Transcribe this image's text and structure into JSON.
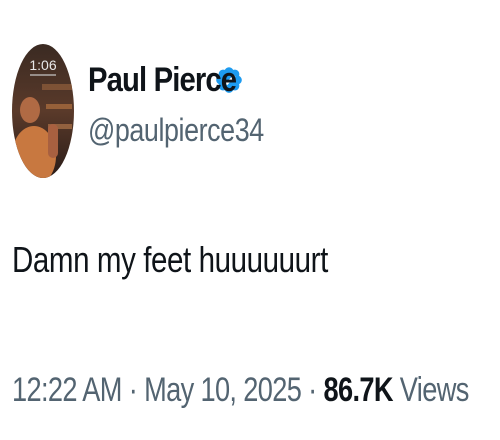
{
  "author": {
    "display_name": "Paul Pierce",
    "handle": "@paulpierce34",
    "verified": true,
    "avatar_lockscreen_time": "1:06",
    "avatar_icon": "avatar-photo"
  },
  "tweet": {
    "text": "Damn my feet huuuuuurt"
  },
  "meta": {
    "time": "12:22 AM",
    "separator_1": " · ",
    "date": "May 10, 2025",
    "separator_2": " · ",
    "views_count": "86.7K",
    "views_label": " Views"
  },
  "colors": {
    "text_primary": "#0f1419",
    "text_secondary": "#536471",
    "verified_blue": "#1d9bf0"
  }
}
